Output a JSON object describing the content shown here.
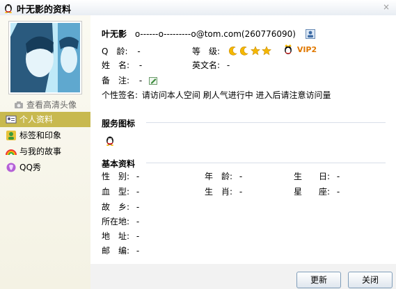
{
  "window": {
    "title": "叶无影的资料",
    "close": "×"
  },
  "sidebar": {
    "view_hd": "查看高清头像",
    "items": [
      {
        "label": "个人资料",
        "active": true
      },
      {
        "label": "标签和印象",
        "active": false
      },
      {
        "label": "与我的故事",
        "active": false
      },
      {
        "label": "QQ秀",
        "active": false
      }
    ]
  },
  "profile": {
    "nickname": "叶无影",
    "email_text": "o------o---------o@tom.com(260776090)",
    "qq_label": "Q　龄:",
    "qq_value": "-",
    "level_label": "等　级:",
    "vip_text": "VIP2",
    "name_label": "姓　名:",
    "name_value": "-",
    "en_name_label": "英文名:",
    "en_name_value": "-",
    "note_label": "备　注:",
    "note_value": "-",
    "signature_label": "个性签名:",
    "signature_value": "请访问本人空间  刷人气进行中 进入后请注意访问量"
  },
  "service": {
    "title": "服务图标"
  },
  "basic": {
    "title": "基本资料",
    "gender_label": "性　别:",
    "gender_value": "-",
    "age_label": "年　龄:",
    "age_value": "-",
    "birthday_label": "生　　日:",
    "birthday_value": "-",
    "blood_label": "血　型:",
    "blood_value": "-",
    "zodiac_label": "生　肖:",
    "zodiac_value": "-",
    "constellation_label": "星　　座:",
    "constellation_value": "-",
    "hometown_label": "故　乡:",
    "hometown_value": "-",
    "location_label": "所在地:",
    "location_value": "-",
    "address_label": "地　址:",
    "address_value": "-",
    "postcode_label": "邮　编:",
    "postcode_value": "-"
  },
  "footer": {
    "refresh_label": "更新",
    "close_label": "关闭"
  }
}
